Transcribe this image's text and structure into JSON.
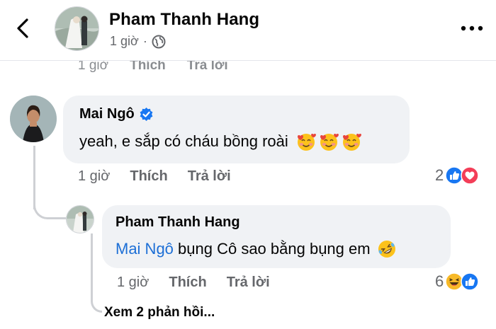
{
  "header": {
    "name": "Pham Thanh Hang",
    "time": "1 giờ",
    "separator": "·"
  },
  "previous_row": {
    "time": "1 giờ",
    "like": "Thích",
    "reply": "Trả lời"
  },
  "comment": {
    "author": "Mai Ngô",
    "verified": true,
    "text": "yeah, e sắp có cháu bồng roài",
    "emojis": [
      "smiling-face-with-hearts",
      "smiling-face-with-hearts",
      "smiling-face-with-hearts"
    ],
    "time": "1 giờ",
    "like": "Thích",
    "reply": "Trả lời",
    "reaction_count": "2",
    "reactions": [
      "like",
      "love"
    ]
  },
  "reply": {
    "author": "Pham Thanh Hang",
    "mention": "Mai Ngô",
    "text": " bụng Cô sao bằng bụng em",
    "emoji": "rolling-on-the-floor-laughing",
    "time": "1 giờ",
    "like": "Thích",
    "reply": "Trả lời",
    "reaction_count": "6",
    "reactions": [
      "haha",
      "like"
    ]
  },
  "view_more": "Xem 2 phản hồi...",
  "colors": {
    "bubble": "#f0f2f5",
    "link": "#1d6fd6",
    "secondary_text": "#65676b",
    "like_blue": "#1877f2",
    "love_red": "#f33e58",
    "haha_yellow": "#f7b928"
  }
}
